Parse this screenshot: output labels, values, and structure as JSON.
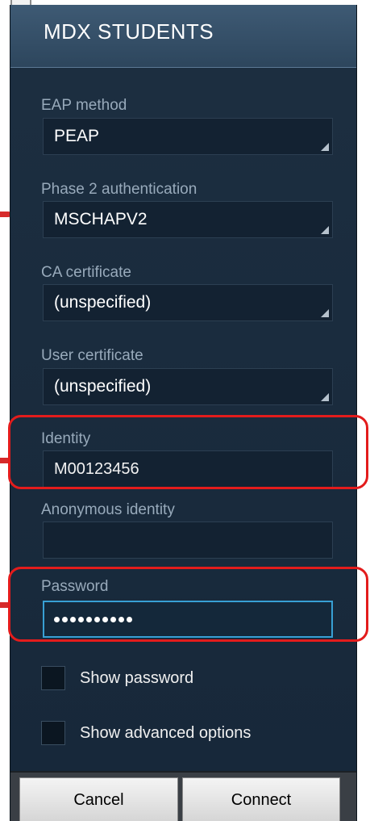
{
  "dialog": {
    "title": "MDX STUDENTS"
  },
  "fields": {
    "eap_method": {
      "label": "EAP method",
      "value": "PEAP"
    },
    "phase2": {
      "label": "Phase 2 authentication",
      "value": "MSCHAPV2"
    },
    "ca_certificate": {
      "label": "CA certificate",
      "value": "(unspecified)"
    },
    "user_certificate": {
      "label": "User certificate",
      "value": "(unspecified)"
    },
    "identity": {
      "label": "Identity",
      "value": "M00123456"
    },
    "anonymous_identity": {
      "label": "Anonymous identity",
      "value": ""
    },
    "password": {
      "label": "Password",
      "masked_char_count": 10
    }
  },
  "checkboxes": {
    "show_password": {
      "label": "Show password",
      "checked": false
    },
    "show_advanced": {
      "label": "Show advanced options",
      "checked": false
    }
  },
  "buttons": {
    "cancel": "Cancel",
    "connect": "Connect"
  },
  "colors": {
    "highlight": "#e31c1c",
    "focus": "#38a0d4",
    "dialog_bg": "#1a2a3a"
  }
}
